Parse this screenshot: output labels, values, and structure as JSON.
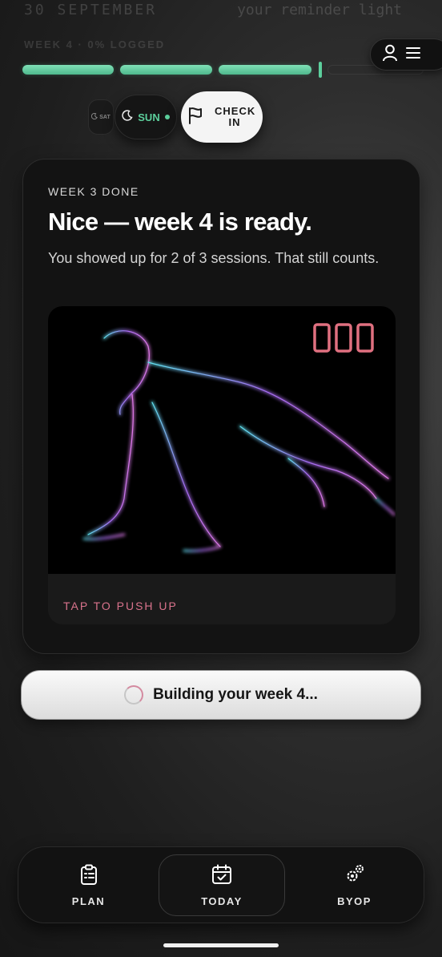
{
  "header": {
    "date_faded": "30 SEPTEMBER",
    "reminder_faded": "your reminder light",
    "week_logged": "WEEK 4 · 0% LOGGED"
  },
  "progress": {
    "weeks_done": 3,
    "current_week": 4,
    "done_color": "#5ccf9c"
  },
  "days": {
    "sat_label": "SAT",
    "sun_label": "SUN",
    "checkin_label": "CHECK IN"
  },
  "card": {
    "eyebrow": "WEEK 3 DONE",
    "headline": "Nice — week 4 is ready.",
    "subtext": "You showed up for 2 of 3 sessions. That still counts.",
    "pushup": {
      "counter": "000",
      "tap_label": "TAP TO PUSH UP",
      "accent": "#d9738c"
    }
  },
  "building": {
    "label": "Building your week 4..."
  },
  "nav": {
    "items": [
      {
        "label": "PLAN",
        "icon": "clipboard-icon"
      },
      {
        "label": "TODAY",
        "icon": "calendar-check-icon",
        "active": true
      },
      {
        "label": "BYOP",
        "icon": "gears-icon"
      }
    ]
  }
}
